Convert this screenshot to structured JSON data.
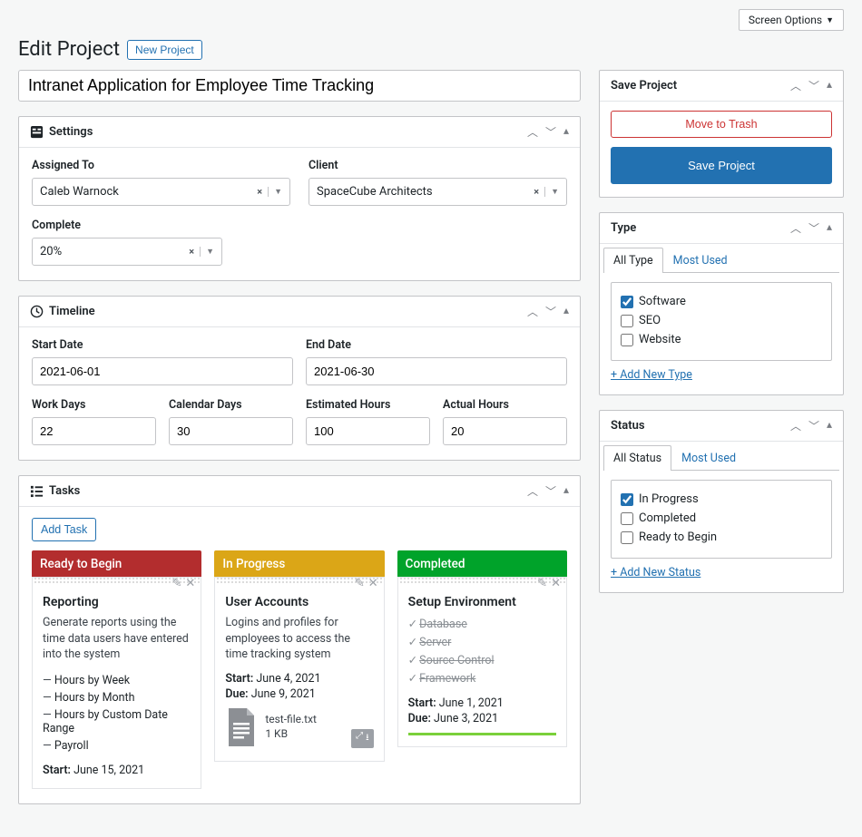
{
  "screen_options": "Screen Options",
  "page_title": "Edit Project",
  "new_project": "New Project",
  "project_title": "Intranet Application for Employee Time Tracking",
  "settings": {
    "heading": "Settings",
    "assigned_to_label": "Assigned To",
    "assigned_to_value": "Caleb Warnock",
    "client_label": "Client",
    "client_value": "SpaceCube Architects",
    "complete_label": "Complete",
    "complete_value": "20%"
  },
  "timeline": {
    "heading": "Timeline",
    "start_date_label": "Start Date",
    "start_date_value": "2021-06-01",
    "end_date_label": "End Date",
    "end_date_value": "2021-06-30",
    "work_days_label": "Work Days",
    "work_days_value": "22",
    "calendar_days_label": "Calendar Days",
    "calendar_days_value": "30",
    "estimated_hours_label": "Estimated Hours",
    "estimated_hours_value": "100",
    "actual_hours_label": "Actual Hours",
    "actual_hours_value": "20"
  },
  "tasks_box": {
    "heading": "Tasks",
    "add_task": "Add Task",
    "cols": {
      "ready": "Ready to Begin",
      "progress": "In Progress",
      "done": "Completed"
    },
    "ready_card": {
      "title": "Reporting",
      "desc": "Generate reports using the time data users have entered into the system",
      "items": [
        "Hours by Week",
        "Hours by Month",
        "Hours by Custom Date Range",
        "Payroll"
      ],
      "start_label": "Start:",
      "start_value": "June 15, 2021"
    },
    "progress_card": {
      "title": "User Accounts",
      "desc": "Logins and profiles for employees to access the time tracking system",
      "start_label": "Start:",
      "start_value": "June 4, 2021",
      "due_label": "Due:",
      "due_value": "June 9, 2021",
      "file_name": "test-file.txt",
      "file_size": "1 KB"
    },
    "done_card": {
      "title": "Setup Environment",
      "items": [
        "Database",
        "Server",
        "Source Control",
        "Framework"
      ],
      "start_label": "Start:",
      "start_value": "June 1, 2021",
      "due_label": "Due:",
      "due_value": "June 3, 2021"
    }
  },
  "save_box": {
    "heading": "Save Project",
    "trash": "Move to Trash",
    "save": "Save Project"
  },
  "type_box": {
    "heading": "Type",
    "tab_all": "All Type",
    "tab_most": "Most Used",
    "items": [
      {
        "label": "Software",
        "checked": true
      },
      {
        "label": "SEO",
        "checked": false
      },
      {
        "label": "Website",
        "checked": false
      }
    ],
    "add_new": "+ Add New Type"
  },
  "status_box": {
    "heading": "Status",
    "tab_all": "All Status",
    "tab_most": "Most Used",
    "items": [
      {
        "label": "In Progress",
        "checked": true
      },
      {
        "label": "Completed",
        "checked": false
      },
      {
        "label": "Ready to Begin",
        "checked": false
      }
    ],
    "add_new": "+ Add New Status"
  }
}
